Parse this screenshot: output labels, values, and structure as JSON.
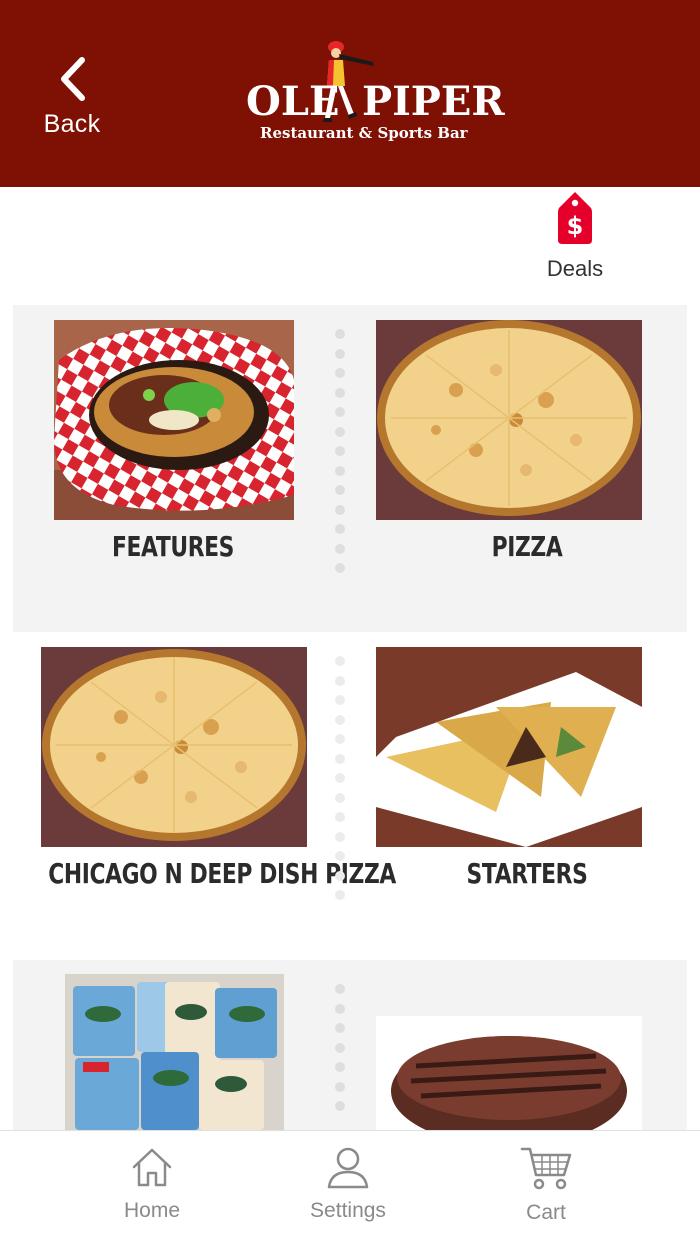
{
  "header": {
    "back_label": "Back",
    "logo": {
      "left_word": "OLE",
      "right_word": "PIPER",
      "subtitle": "Restaurant & Sports Bar"
    },
    "background": "#7e1004"
  },
  "deals": {
    "label": "Deals",
    "icon": "price-tag-dollar-icon",
    "color": "#e4002b"
  },
  "categories": [
    {
      "label": "FEATURES",
      "image": "loaded-fries-with-green-onions"
    },
    {
      "label": "PIZZA",
      "image": "cheese-pizza"
    },
    {
      "label": "CHICAGO N DEEP DISH PIZZA",
      "image": "deep-dish-pizza"
    },
    {
      "label": "STARTERS",
      "image": "quesadilla-on-plate"
    },
    {
      "label": "",
      "image": "salad-dressing-packets"
    },
    {
      "label": "",
      "image": "grilled-burger-patty"
    }
  ],
  "tabbar": {
    "items": [
      {
        "label": "Home",
        "icon": "home-icon"
      },
      {
        "label": "Settings",
        "icon": "user-icon"
      },
      {
        "label": "Cart",
        "icon": "cart-icon"
      }
    ]
  }
}
